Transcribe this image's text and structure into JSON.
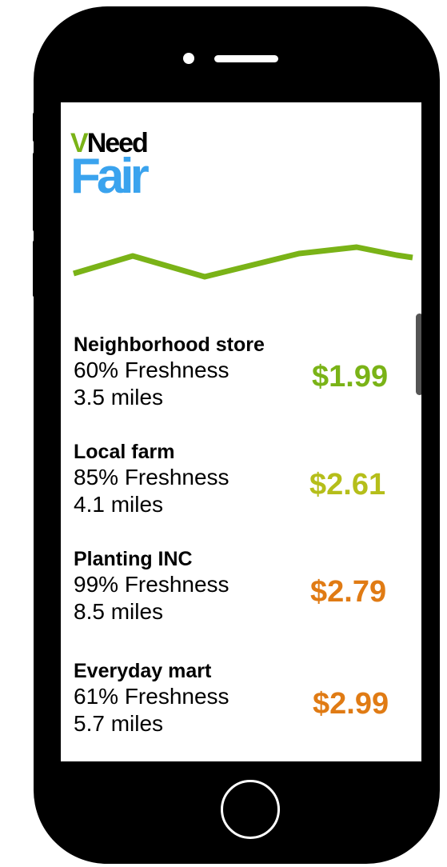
{
  "app": {
    "logo_v": "V",
    "logo_need": "Need",
    "logo_fair": "Fair"
  },
  "trend_line_color": "#7ab317",
  "stores": [
    {
      "name": "Neighborhood store",
      "freshness": "60% Freshness",
      "distance": "3.5 miles",
      "price": "$1.99",
      "price_color": "#7ab317"
    },
    {
      "name": "Local farm",
      "freshness": "85% Freshness",
      "distance": "4.1 miles",
      "price": "$2.61",
      "price_color": "#b5be1a"
    },
    {
      "name": "Planting INC",
      "freshness": "99% Freshness",
      "distance": "8.5 miles",
      "price": "$2.79",
      "price_color": "#e07b14"
    },
    {
      "name": "Everyday mart",
      "freshness": "61% Freshness",
      "distance": "5.7 miles",
      "price": "$2.99",
      "price_color": "#e07b14"
    }
  ]
}
